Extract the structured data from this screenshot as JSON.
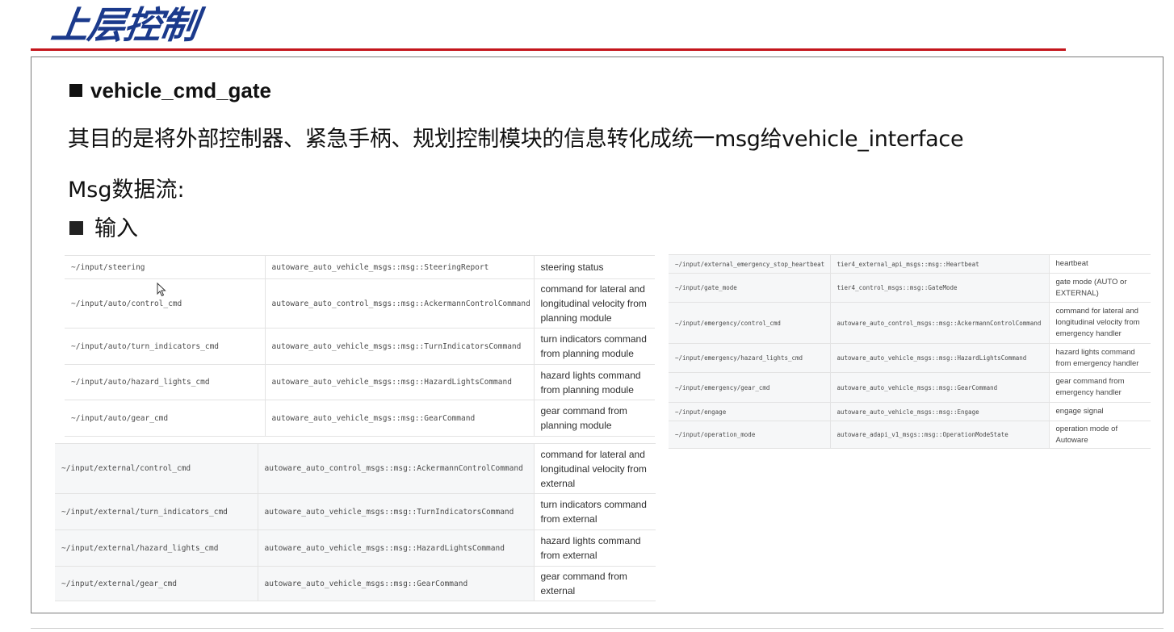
{
  "slide": {
    "title": "上层控制",
    "heading": "vehicle_cmd_gate",
    "description": "其目的是将外部控制器、紧急手柄、规划控制模块的信息转化成统一msg给vehicle_interface",
    "msg_label": "Msg数据流:",
    "input_label": "输入"
  },
  "tables": {
    "auto": [
      {
        "topic": "~/input/steering",
        "type": "autoware_auto_vehicle_msgs::msg::SteeringReport",
        "desc": "steering status"
      },
      {
        "topic": "~/input/auto/control_cmd",
        "type": "autoware_auto_control_msgs::msg::AckermannControlCommand",
        "desc": "command for lateral and longitudinal velocity from planning module"
      },
      {
        "topic": "~/input/auto/turn_indicators_cmd",
        "type": "autoware_auto_vehicle_msgs::msg::TurnIndicatorsCommand",
        "desc": "turn indicators command from planning module"
      },
      {
        "topic": "~/input/auto/hazard_lights_cmd",
        "type": "autoware_auto_vehicle_msgs::msg::HazardLightsCommand",
        "desc": "hazard lights command from planning module"
      },
      {
        "topic": "~/input/auto/gear_cmd",
        "type": "autoware_auto_vehicle_msgs::msg::GearCommand",
        "desc": "gear command from planning module"
      }
    ],
    "external": [
      {
        "topic": "~/input/external/control_cmd",
        "type": "autoware_auto_control_msgs::msg::AckermannControlCommand",
        "desc": "command for lateral and longitudinal velocity from external"
      },
      {
        "topic": "~/input/external/turn_indicators_cmd",
        "type": "autoware_auto_vehicle_msgs::msg::TurnIndicatorsCommand",
        "desc": "turn indicators command from external"
      },
      {
        "topic": "~/input/external/hazard_lights_cmd",
        "type": "autoware_auto_vehicle_msgs::msg::HazardLightsCommand",
        "desc": "hazard lights command from external"
      },
      {
        "topic": "~/input/external/gear_cmd",
        "type": "autoware_auto_vehicle_msgs::msg::GearCommand",
        "desc": "gear command from external"
      }
    ],
    "right": [
      {
        "topic": "~/input/external_emergency_stop_heartbeat",
        "type": "tier4_external_api_msgs::msg::Heartbeat",
        "desc": "heartbeat"
      },
      {
        "topic": "~/input/gate_mode",
        "type": "tier4_control_msgs::msg::GateMode",
        "desc": "gate mode (AUTO or EXTERNAL)"
      },
      {
        "topic": "~/input/emergency/control_cmd",
        "type": "autoware_auto_control_msgs::msg::AckermannControlCommand",
        "desc": "command for lateral and longitudinal velocity from emergency handler"
      },
      {
        "topic": "~/input/emergency/hazard_lights_cmd",
        "type": "autoware_auto_vehicle_msgs::msg::HazardLightsCommand",
        "desc": "hazard lights command from emergency handler"
      },
      {
        "topic": "~/input/emergency/gear_cmd",
        "type": "autoware_auto_vehicle_msgs::msg::GearCommand",
        "desc": "gear command from emergency handler"
      },
      {
        "topic": "~/input/engage",
        "type": "autoware_auto_vehicle_msgs::msg::Engage",
        "desc": "engage signal"
      },
      {
        "topic": "~/input/operation_mode",
        "type": "autoware_adapi_v1_msgs::msg::OperationModeState",
        "desc": "operation mode of Autoware"
      }
    ]
  },
  "icons": {
    "cursor": "mouse-pointer-icon"
  },
  "colors": {
    "title": "#1b3a8c",
    "title_rule": "#c4161c",
    "frame": "#7a7a7a"
  }
}
